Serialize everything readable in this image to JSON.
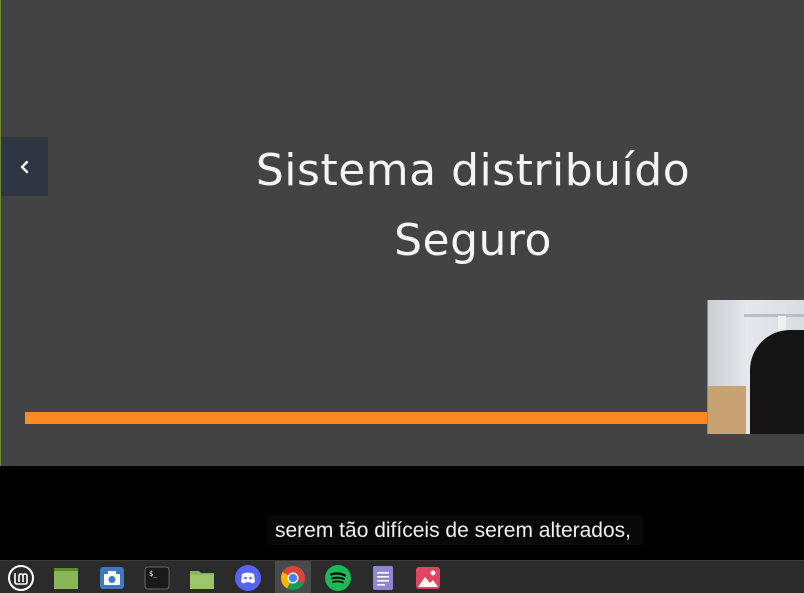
{
  "slide": {
    "title_line1": "Sistema distribuído",
    "title_line2": "Seguro",
    "accent_color": "#ff8a1f",
    "background_color": "#434343"
  },
  "navigation": {
    "prev_icon": "chevron-left-icon"
  },
  "captions": {
    "text": "serem tão difíceis de serem alterados,"
  },
  "taskbar": {
    "items": [
      {
        "name": "mint-menu",
        "icon": "linux-mint-logo-icon"
      },
      {
        "name": "show-desktop",
        "icon": "desktop-icon"
      },
      {
        "name": "screenshot-app",
        "icon": "camera-icon"
      },
      {
        "name": "terminal",
        "icon": "terminal-icon"
      },
      {
        "name": "file-manager",
        "icon": "folder-icon"
      },
      {
        "name": "discord",
        "icon": "discord-icon"
      },
      {
        "name": "chrome",
        "icon": "chrome-icon",
        "active": true
      },
      {
        "name": "spotify",
        "icon": "spotify-icon"
      },
      {
        "name": "text-editor",
        "icon": "document-icon"
      },
      {
        "name": "image-viewer",
        "icon": "image-icon"
      }
    ]
  }
}
